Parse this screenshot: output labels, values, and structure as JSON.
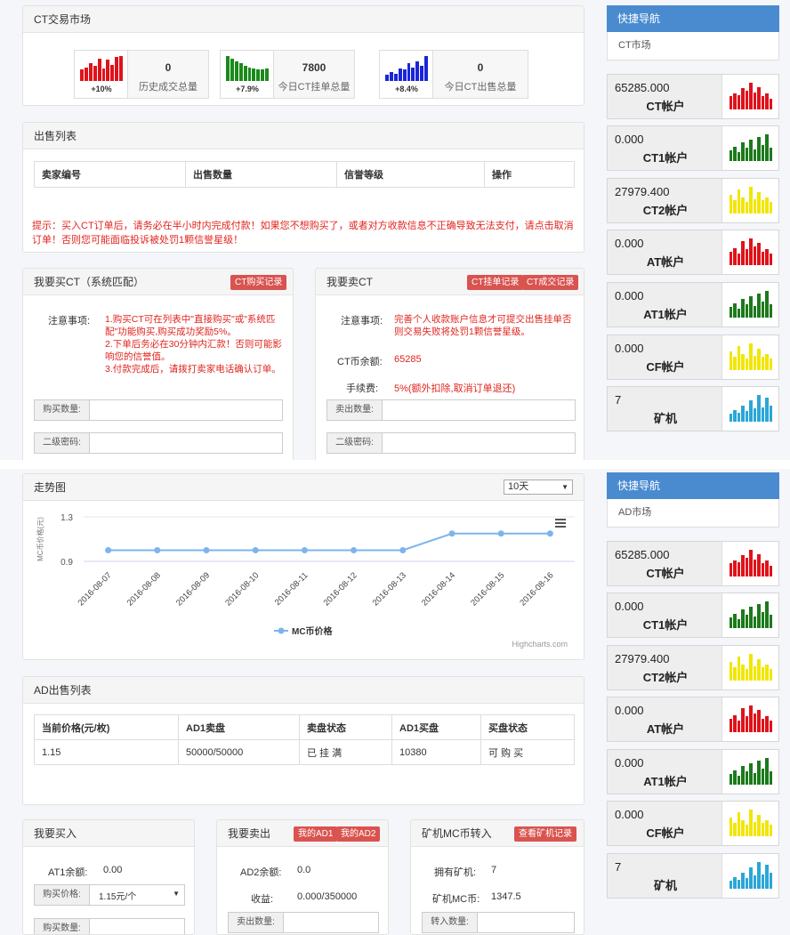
{
  "ct_market": {
    "title": "CT交易市场",
    "stats": [
      {
        "value": "0",
        "label": "历史成交总量",
        "pct": "+10%",
        "color": "#e0121a",
        "pct_color": "#333",
        "bars": [
          0.45,
          0.55,
          0.7,
          0.6,
          0.9,
          0.5,
          0.85,
          0.65,
          0.95,
          1
        ]
      },
      {
        "value": "7800",
        "label": "今日CT挂单总量",
        "pct": "+7.9%",
        "color": "#1b8a1b",
        "pct_color": "#333",
        "bars": [
          1,
          0.9,
          0.8,
          0.7,
          0.6,
          0.55,
          0.5,
          0.45,
          0.45,
          0.5
        ]
      },
      {
        "value": "0",
        "label": "今日CT出售总量",
        "pct": "+8.4%",
        "color": "#1a25d8",
        "pct_color": "#333",
        "bars": [
          0.25,
          0.35,
          0.3,
          0.5,
          0.45,
          0.7,
          0.55,
          0.8,
          0.6,
          1
        ]
      }
    ]
  },
  "sell_list": {
    "title": "出售列表",
    "headers": [
      "卖家编号",
      "出售数量",
      "信誉等级",
      "操作"
    ],
    "notice": "提示：买入CT订单后，请务必在半小时内完成付款！如果您不想购买了，或者对方收款信息不正确导致无法支付，请点击取消订单！否则您可能面临投诉被处罚1颗信誉星级！"
  },
  "buy_ct": {
    "title": "我要买CT（系统匹配）",
    "record_btn": "CT购买记录",
    "note_label": "注意事项:",
    "notes": [
      "1.购买CT可在列表中\"直接购买\"或\"系统匹配\"功能购买,购买成功奖励5%。",
      "2.下单后务必在30分钟内汇款！否则可能影响您的信誉值。",
      "3.付款完成后，请拨打卖家电话确认订单。"
    ],
    "qty_label": "购买数量:",
    "pwd_label": "二级密码:"
  },
  "sell_ct": {
    "title": "我要卖CT",
    "btn1": "CT挂单记录",
    "btn2": "CT成交记录",
    "note_label": "注意事项:",
    "note": "完善个人收款账户信息才可提交出售挂单否则交易失败将处罚1颗信誉星级。",
    "balance_label": "CT币余额:",
    "balance": "65285",
    "fee_label": "手续费:",
    "fee": "5%(额外扣除,取消订单退还)",
    "qty_label": "卖出数量:",
    "pwd_label": "二级密码:"
  },
  "trend": {
    "title": "走势图",
    "range": "10天",
    "credit": "Highcharts.com"
  },
  "chart_data": {
    "type": "line",
    "x": [
      "2016-08-07",
      "2016-08-08",
      "2016-08-09",
      "2016-08-10",
      "2016-08-11",
      "2016-08-12",
      "2016-08-13",
      "2016-08-14",
      "2016-08-15",
      "2016-08-16"
    ],
    "series": [
      {
        "name": "MC币价格",
        "values": [
          1,
          1,
          1,
          1,
          1,
          1,
          1,
          1.15,
          1.15,
          1.15
        ]
      }
    ],
    "ylabel": "MC币价格(元)",
    "yticks": [
      0.9,
      1.3
    ],
    "ylim": [
      0.9,
      1.3
    ],
    "grid": true,
    "legend": "bottom"
  },
  "ad_list": {
    "title": "AD出售列表",
    "headers": [
      "当前价格(元/枚)",
      "AD1卖盘",
      "卖盘状态",
      "AD1买盘",
      "买盘状态"
    ],
    "rows": [
      [
        "1.15",
        "50000/50000",
        "已 挂 满",
        "10380",
        "可 购 买"
      ]
    ]
  },
  "buy_in": {
    "title": "我要买入",
    "balance_label": "AT1余额:",
    "balance": "0.00",
    "price_label": "购买价格:",
    "price": "1.15元/个",
    "qty_label": "购买数量:"
  },
  "sell_out": {
    "title": "我要卖出",
    "btn1": "我的AD1",
    "btn2": "我的AD2",
    "balance_label": "AD2余额:",
    "balance": "0.0",
    "income_label": "收益:",
    "income": "0.000/350000",
    "qty_label": "卖出数量:"
  },
  "miner": {
    "title": "矿机MC币转入",
    "btn": "查看矿机记录",
    "own_label": "拥有矿机:",
    "own": "7",
    "mc_label": "矿机MC币:",
    "mc": "1347.5",
    "qty_label": "转入数量:"
  },
  "nav1": {
    "title": "快捷导航",
    "item": "CT市场"
  },
  "nav2": {
    "title": "快捷导航",
    "item": "AD市场"
  },
  "accounts": [
    {
      "value": "65285.000",
      "name": "CT帐户",
      "color": "#e0121a",
      "bars": [
        0.5,
        0.6,
        0.55,
        0.8,
        0.7,
        1,
        0.65,
        0.85,
        0.5,
        0.6,
        0.4
      ]
    },
    {
      "value": "0.000",
      "name": "CT1帐户",
      "color": "#1b7a1b",
      "bars": [
        0.4,
        0.55,
        0.35,
        0.7,
        0.5,
        0.8,
        0.45,
        0.9,
        0.6,
        1,
        0.5
      ]
    },
    {
      "value": "27979.400",
      "name": "CT2帐户",
      "color": "#f2e600",
      "bars": [
        0.7,
        0.5,
        0.9,
        0.6,
        0.45,
        1,
        0.55,
        0.8,
        0.5,
        0.6,
        0.45
      ]
    },
    {
      "value": "0.000",
      "name": "AT帐户",
      "color": "#e0121a",
      "bars": [
        0.5,
        0.65,
        0.45,
        0.9,
        0.6,
        1,
        0.7,
        0.85,
        0.5,
        0.6,
        0.45
      ]
    },
    {
      "value": "0.000",
      "name": "AT1帐户",
      "color": "#1b7a1b",
      "bars": [
        0.4,
        0.55,
        0.35,
        0.7,
        0.5,
        0.8,
        0.45,
        0.9,
        0.6,
        1,
        0.5
      ]
    },
    {
      "value": "0.000",
      "name": "CF帐户",
      "color": "#f2e600",
      "bars": [
        0.7,
        0.5,
        0.9,
        0.6,
        0.45,
        1,
        0.55,
        0.8,
        0.5,
        0.6,
        0.45
      ]
    },
    {
      "value": "7",
      "name": "矿机",
      "color": "#2aa7d6",
      "bars": [
        0.3,
        0.45,
        0.35,
        0.6,
        0.4,
        0.8,
        0.5,
        1,
        0.55,
        0.9,
        0.6
      ]
    }
  ]
}
